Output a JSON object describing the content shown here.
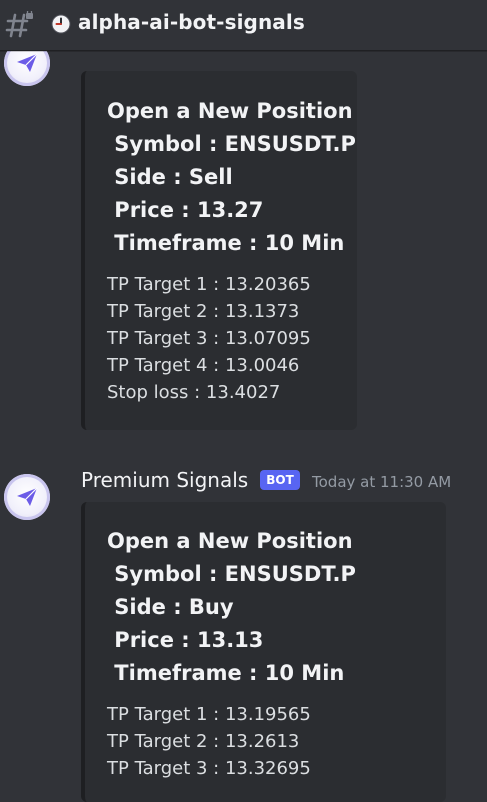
{
  "channel": {
    "name": "alpha-ai-bot-signals",
    "icon": "clock-icon"
  },
  "messages": [
    {
      "author": "",
      "embed": {
        "title": "Open a New Position",
        "fields": [
          " Symbol : ENSUSDT.P",
          " Side : Sell",
          " Price : 13.27",
          " Timeframe : 10 Min"
        ],
        "targets": [
          "TP Target 1 : 13.20365",
          "TP Target 2 : 13.1373",
          "TP Target 3 : 13.07095",
          "TP Target 4 : 13.0046",
          "Stop loss : 13.4027"
        ]
      }
    },
    {
      "author": "Premium Signals",
      "badge": "BOT",
      "timestamp": "Today at 11:30 AM",
      "embed": {
        "title": "Open a New Position",
        "fields": [
          " Symbol : ENSUSDT.P",
          " Side : Buy",
          " Price : 13.13",
          " Timeframe : 10 Min"
        ],
        "targets": [
          "TP Target 1 : 13.19565",
          "TP Target 2 : 13.2613",
          "TP Target 3 : 13.32695"
        ]
      }
    }
  ],
  "colors": {
    "background": "#313338",
    "embed": "#2b2d31",
    "accent": "#5865f2",
    "timestamp": "#949ba4"
  }
}
